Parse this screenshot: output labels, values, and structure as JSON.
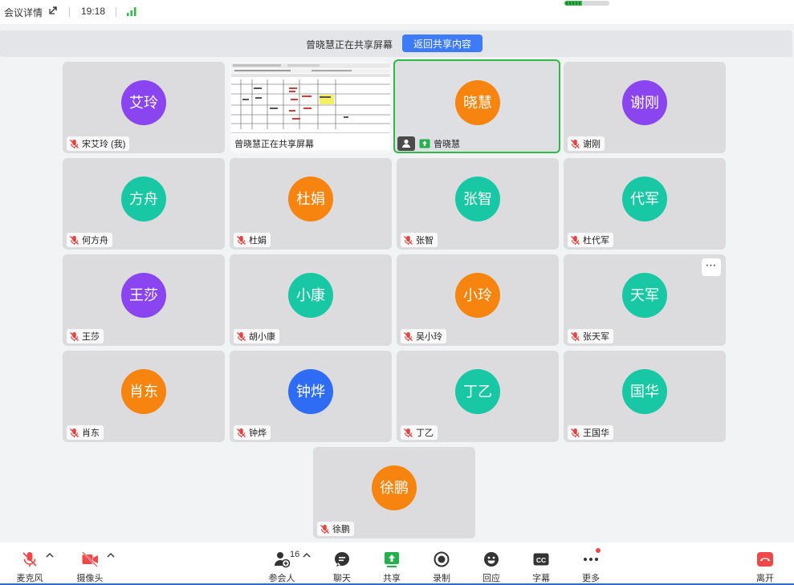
{
  "titlebar": {
    "meeting_details": "会议详情",
    "time": "19:18"
  },
  "banner": {
    "text": "曾晓慧正在共享屏幕",
    "return_label": "返回共享内容"
  },
  "shared_screen": {
    "label": "曾晓慧正在共享屏幕"
  },
  "participants": [
    {
      "avatar": "艾玲",
      "name": "宋艾玲 (我)",
      "color": "#8b45f0",
      "muted": true
    },
    {
      "avatar": "晓慧",
      "name": "曾晓慧",
      "color": "#f7840f",
      "muted": false,
      "host": true,
      "sharing": true,
      "speaking": true
    },
    {
      "avatar": "谢刚",
      "name": "谢刚",
      "color": "#8b45f0",
      "muted": true
    },
    {
      "avatar": "方舟",
      "name": "何方舟",
      "color": "#18c8a4",
      "muted": true
    },
    {
      "avatar": "杜娟",
      "name": "杜娟",
      "color": "#f7840f",
      "muted": true
    },
    {
      "avatar": "张智",
      "name": "张智",
      "color": "#18c8a4",
      "muted": true
    },
    {
      "avatar": "代军",
      "name": "杜代军",
      "color": "#18c8a4",
      "muted": true
    },
    {
      "avatar": "王莎",
      "name": "王莎",
      "color": "#8b45f0",
      "muted": true
    },
    {
      "avatar": "小康",
      "name": "胡小康",
      "color": "#18c8a4",
      "muted": true
    },
    {
      "avatar": "小玲",
      "name": "吴小玲",
      "color": "#f7840f",
      "muted": true
    },
    {
      "avatar": "天军",
      "name": "张天军",
      "color": "#18c8a4",
      "muted": true
    },
    {
      "avatar": "肖东",
      "name": "肖东",
      "color": "#f7840f",
      "muted": true
    },
    {
      "avatar": "钟烨",
      "name": "钟烨",
      "color": "#2f6cf6",
      "muted": true
    },
    {
      "avatar": "丁乙",
      "name": "丁乙",
      "color": "#18c8a4",
      "muted": true
    },
    {
      "avatar": "国华",
      "name": "王国华",
      "color": "#18c8a4",
      "muted": true
    },
    {
      "avatar": "徐鹏",
      "name": "徐鹏",
      "color": "#f7840f",
      "muted": true
    }
  ],
  "toolbar": {
    "mic": "麦克风",
    "camera": "摄像头",
    "participants": "参会人",
    "participant_count": "16",
    "chat": "聊天",
    "share": "共享",
    "record": "录制",
    "react": "回应",
    "captions": "字幕",
    "captions_icon_text": "CC",
    "more": "更多",
    "leave": "离开"
  },
  "colors": {
    "accent": "#3d7bfa",
    "speaking_border": "#2dbb46",
    "danger": "#f04848"
  }
}
